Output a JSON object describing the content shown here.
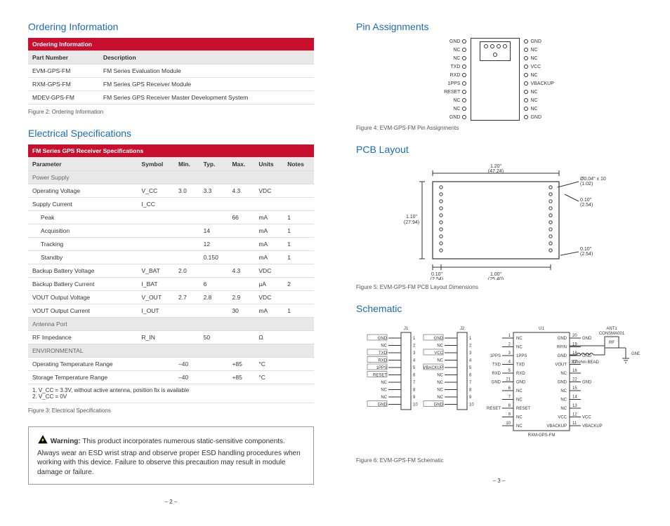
{
  "left": {
    "ordering": {
      "heading": "Ordering Information",
      "tableTitle": "Ordering Information",
      "colPart": "Part Number",
      "colDesc": "Description",
      "rows": [
        {
          "pn": "EVM-GPS-FM",
          "desc": "FM Series Evaluation Module"
        },
        {
          "pn": "RXM-GPS-FM",
          "desc": "FM Series GPS Receiver Module"
        },
        {
          "pn": "MDEV-GPS-FM",
          "desc": "FM Series GPS Receiver Master Development System"
        }
      ],
      "caption": "Figure 2: Ordering Information"
    },
    "elec": {
      "heading": "Electrical Specifications",
      "tableTitle": "FM Series GPS Receiver Specifications",
      "cols": [
        "Parameter",
        "Symbol",
        "Min.",
        "Typ.",
        "Max.",
        "Units",
        "Notes"
      ],
      "powerSupplyLabel": "Power Supply",
      "rows": [
        {
          "p": "Operating Voltage",
          "s": "V_CC",
          "min": "3.0",
          "typ": "3.3",
          "max": "4.3",
          "u": "VDC",
          "n": ""
        },
        {
          "p": "Supply Current",
          "s": "I_CC",
          "min": "",
          "typ": "",
          "max": "",
          "u": "",
          "n": ""
        },
        {
          "p": "Peak",
          "indent": true,
          "s": "",
          "min": "",
          "typ": "",
          "max": "66",
          "u": "mA",
          "n": "1"
        },
        {
          "p": "Acquisition",
          "indent": true,
          "s": "",
          "min": "",
          "typ": "14",
          "max": "",
          "u": "mA",
          "n": "1"
        },
        {
          "p": "Tracking",
          "indent": true,
          "s": "",
          "min": "",
          "typ": "12",
          "max": "",
          "u": "mA",
          "n": "1"
        },
        {
          "p": "Standby",
          "indent": true,
          "s": "",
          "min": "",
          "typ": "0.150",
          "max": "",
          "u": "mA",
          "n": "1"
        },
        {
          "p": "Backup Battery Voltage",
          "s": "V_BAT",
          "min": "2.0",
          "typ": "",
          "max": "4.3",
          "u": "VDC",
          "n": ""
        },
        {
          "p": "Backup Battery Current",
          "s": "I_BAT",
          "min": "",
          "typ": "6",
          "max": "",
          "u": "µA",
          "n": "2"
        },
        {
          "p": "VOUT Output Voltage",
          "s": "V_OUT",
          "min": "2.7",
          "typ": "2.8",
          "max": "2.9",
          "u": "VDC",
          "n": ""
        },
        {
          "p": "VOUT Output Current",
          "s": "I_OUT",
          "min": "",
          "typ": "",
          "max": "30",
          "u": "mA",
          "n": "1"
        }
      ],
      "antennaLabel": "Antenna Port",
      "rfRow": {
        "p": "RF Impedance",
        "s": "R_IN",
        "min": "",
        "typ": "50",
        "max": "",
        "u": "Ω",
        "n": ""
      },
      "envLabel": "ENVIRONMENTAL",
      "envRows": [
        {
          "p": "Operating Temperature Range",
          "s": "",
          "min": "–40",
          "typ": "",
          "max": "+85",
          "u": "°C",
          "n": ""
        },
        {
          "p": "Storage Temperature Range",
          "s": "",
          "min": "–40",
          "typ": "",
          "max": "+85",
          "u": "°C",
          "n": ""
        }
      ],
      "note1": "1.    V_CC = 3.3V, without active antenna, position fix is available",
      "note2": "2.    V_CC = 0V",
      "caption": "Figure 3: Electrical Specifications"
    },
    "warning": {
      "label": "Warning:",
      "text": " This product incorporates numerous static-sensitive components. Always wear an ESD wrist strap and observe proper ESD handling procedures when working with this device. Failure to observe this precaution may result in module damage or failure."
    },
    "pagenum": "–  2  –"
  },
  "right": {
    "pins": {
      "heading": "Pin Assignments",
      "left": [
        "GND",
        "NC",
        "NC",
        "TXD",
        "RXD",
        "1PPS",
        "RESET",
        "NC",
        "NC",
        "GND"
      ],
      "right": [
        "GND",
        "NC",
        "NC",
        "VCC",
        "NC",
        "VBACKUP",
        "NC",
        "NC",
        "NC",
        "GND"
      ],
      "caption": "Figure 4: EVM-GPS-FM Pin Assignments"
    },
    "pcb": {
      "heading": "PCB Layout",
      "caption": "Figure 5: EVM-GPS-FM PCB Layout Dimensions",
      "dims": {
        "width_in": "1.20\"",
        "width_mm": "(47.24)",
        "height_in": "1.10\"",
        "height_mm": "(27.94)",
        "holes": "Ø0.04\" x 10",
        "holes_mm": "(1.02)",
        "pitch_in": "0.10\"",
        "pitch_mm": "(2.54)",
        "offset_in": "0.10\"",
        "offset_mm": "(2.54)",
        "row_in": "1.00\"",
        "row_mm": "(25.40)",
        "edge_in": "0.10\"",
        "edge_mm": "(2.54)"
      }
    },
    "schem": {
      "heading": "Schematic",
      "caption": "Figure 6: EVM-GPS-FM Schematic",
      "J1": {
        "name": "J1",
        "pins": [
          "GND",
          "NC",
          "TXD",
          "RXD",
          "1PPS",
          "RESET",
          "NC",
          "NC",
          "NC",
          "GND"
        ],
        "nums": [
          "1",
          "2",
          "3",
          "4",
          "5",
          "6",
          "7",
          "8",
          "9",
          "10"
        ]
      },
      "J2": {
        "name": "J2",
        "pins": [
          "GND",
          "NC",
          "VCC",
          "NC",
          "VBACKUP",
          "NC",
          "NC",
          "NC",
          "NC",
          "GND"
        ],
        "nums": [
          "1",
          "2",
          "3",
          "4",
          "5",
          "6",
          "7",
          "8",
          "9",
          "10"
        ]
      },
      "U1": {
        "name": "U1",
        "module": "RXM-GPS-FM",
        "left": [
          {
            "n": "1",
            "l": "NC"
          },
          {
            "n": "2",
            "l": "NC"
          },
          {
            "n": "3",
            "l": "1PPS"
          },
          {
            "n": "4",
            "l": "TXD"
          },
          {
            "n": "5",
            "l": "RXD"
          },
          {
            "n": "21",
            "l": "GND"
          },
          {
            "n": "6",
            "l": "NC"
          },
          {
            "n": "7",
            "l": "NC"
          },
          {
            "n": "8",
            "l": "RESET"
          },
          {
            "n": "9",
            "l": "NC"
          },
          {
            "n": "10",
            "l": "NC"
          }
        ],
        "right": [
          {
            "n": "20",
            "l": "GND"
          },
          {
            "n": "19",
            "l": "RFIN"
          },
          {
            "n": "18",
            "l": "GND"
          },
          {
            "n": "17",
            "l": "VOUT"
          },
          {
            "n": "16",
            "l": "NC"
          },
          {
            "n": "22",
            "l": "GND"
          },
          {
            "n": "15",
            "l": "NC"
          },
          {
            "n": "14",
            "l": "NC"
          },
          {
            "n": "13",
            "l": "NC"
          },
          {
            "n": "12",
            "l": "VCC"
          },
          {
            "n": "11",
            "l": "VBACKUP"
          }
        ]
      },
      "ant": {
        "name": "ANT1",
        "part": "CONSMA001",
        "rf": "RF",
        "gnd": "GND"
      },
      "bead": "300ohm BEAD",
      "nets": [
        "GND",
        "1PPS",
        "TXD",
        "RXD",
        "RESET",
        "VCC",
        "VBACKUP"
      ]
    },
    "pagenum": "–  3  –"
  }
}
